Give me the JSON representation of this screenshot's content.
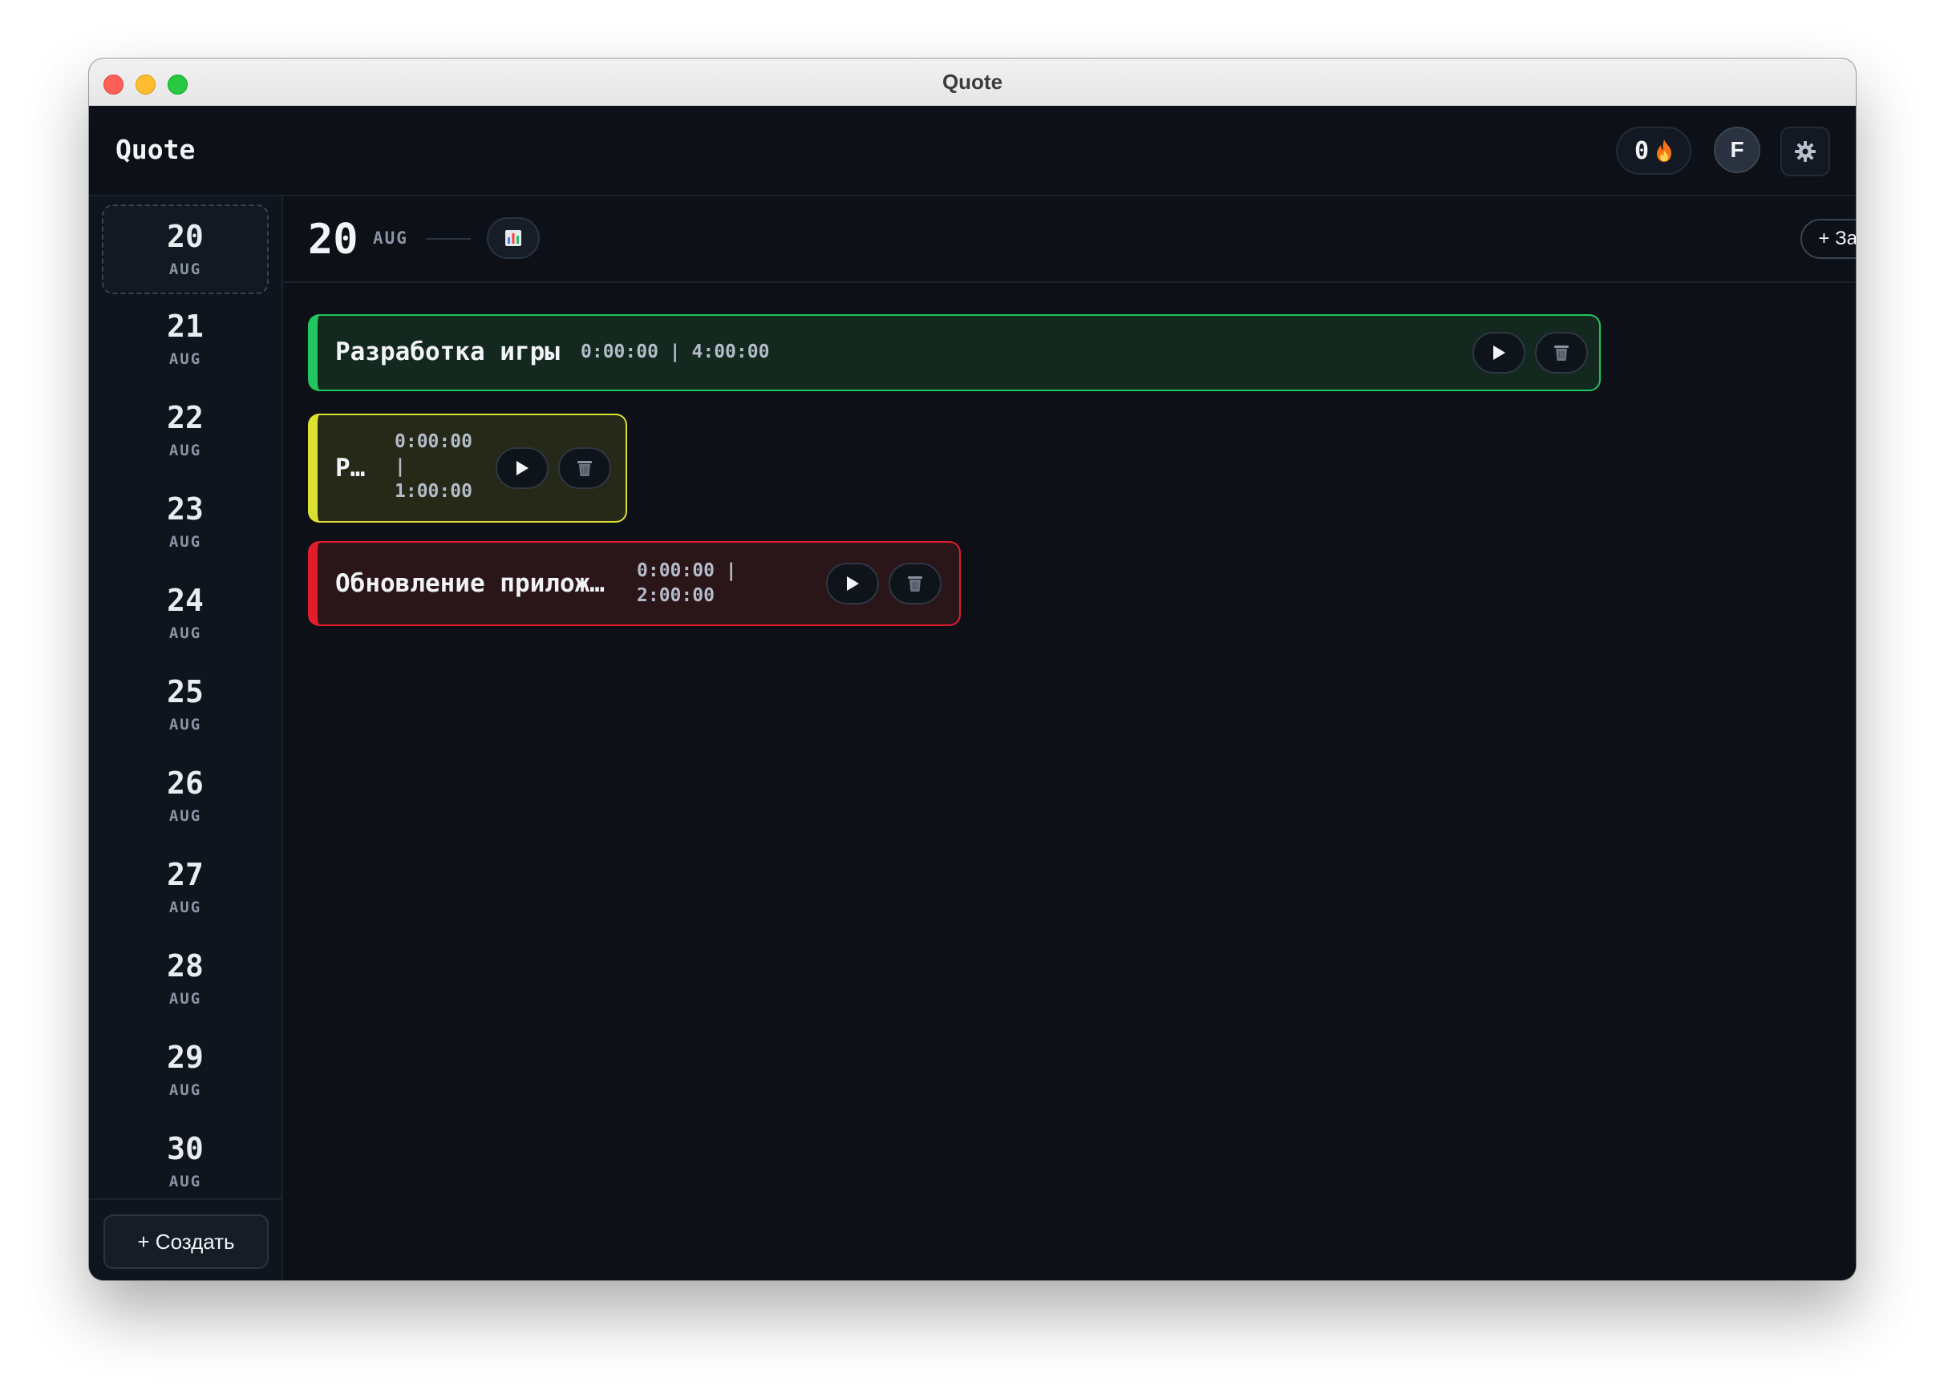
{
  "window": {
    "title": "Quote"
  },
  "header": {
    "brand": "Quote",
    "streak_count": "0",
    "streak_icon": "fire-icon",
    "avatar_letter": "F",
    "settings_icon": "gear-icon"
  },
  "sidebar": {
    "days": [
      {
        "num": "20",
        "mon": "AUG",
        "active": true
      },
      {
        "num": "21",
        "mon": "AUG"
      },
      {
        "num": "22",
        "mon": "AUG"
      },
      {
        "num": "23",
        "mon": "AUG"
      },
      {
        "num": "24",
        "mon": "AUG"
      },
      {
        "num": "25",
        "mon": "AUG"
      },
      {
        "num": "26",
        "mon": "AUG"
      },
      {
        "num": "27",
        "mon": "AUG"
      },
      {
        "num": "28",
        "mon": "AUG"
      },
      {
        "num": "29",
        "mon": "AUG"
      },
      {
        "num": "30",
        "mon": "AUG"
      }
    ],
    "create_label": "+ Создать"
  },
  "main": {
    "date_num": "20",
    "date_mon": "AUG",
    "stats_icon": "bar-chart-icon",
    "add_task_label": "+ Задача",
    "tasks": [
      {
        "name": "Разработка игры",
        "elapsed": "0:00:00",
        "separator": "|",
        "planned": "4:00:00",
        "color": "#22c55e"
      },
      {
        "name": "Р…",
        "elapsed": "0:00:00",
        "separator": "|",
        "planned": "1:00:00",
        "color": "#dce031"
      },
      {
        "name": "Обновление прилож…",
        "elapsed": "0:00:00",
        "separator": "|",
        "planned": "2:00:00",
        "color": "#e11d2d"
      }
    ]
  }
}
